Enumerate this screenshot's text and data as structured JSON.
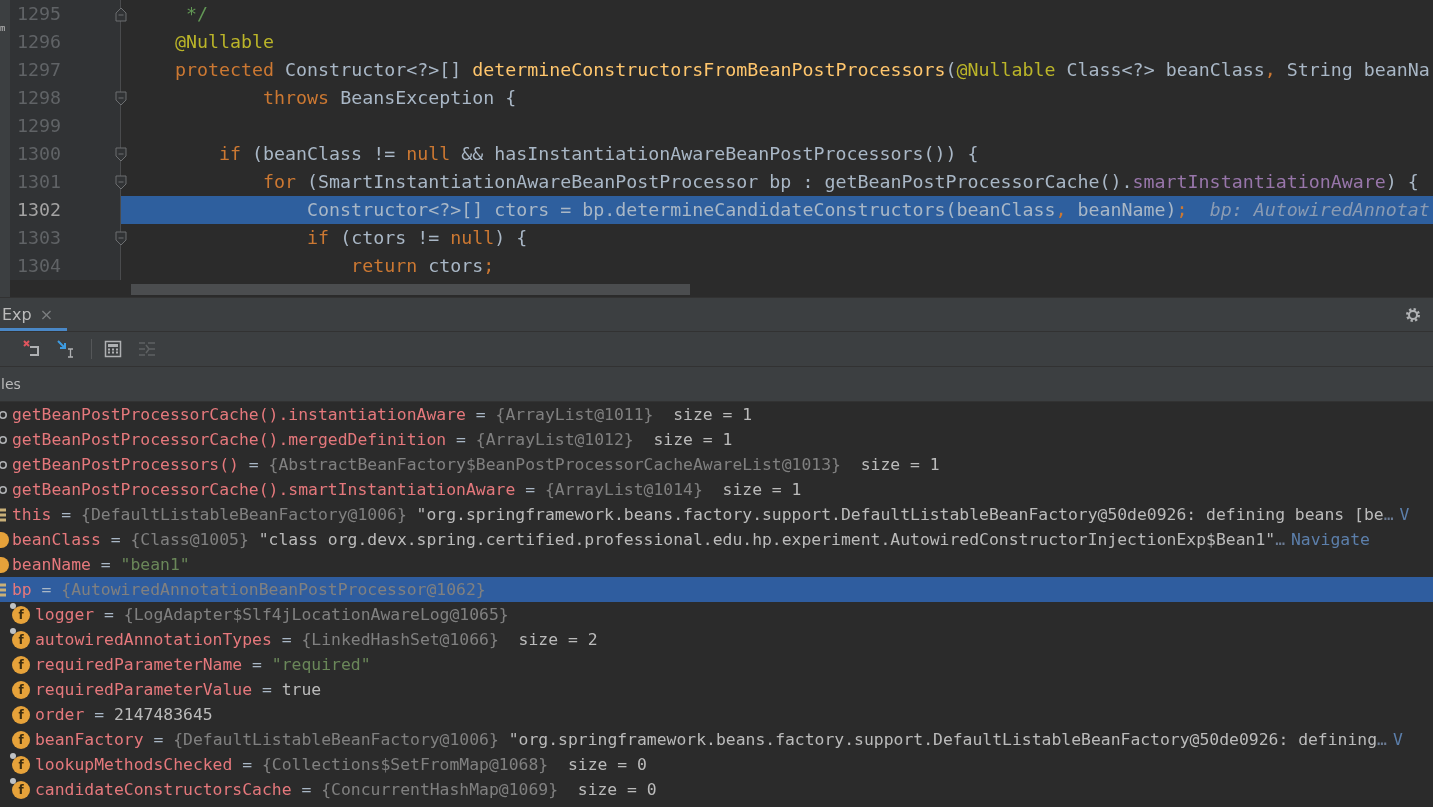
{
  "editor": {
    "edge_text": "m",
    "lines": [
      {
        "number": "1295",
        "current": false,
        "fold_start": false,
        "fold_end": true,
        "tokens": [
          {
            "text": "     */",
            "kind": "comment"
          }
        ]
      },
      {
        "number": "1296",
        "current": false,
        "fold_start": false,
        "fold_end": false,
        "tokens": [
          {
            "text": "    @Nullable",
            "kind": "annotation"
          }
        ]
      },
      {
        "number": "1297",
        "current": false,
        "fold_start": false,
        "fold_end": false,
        "tokens": [
          {
            "text": "    protected",
            "kind": "keyword"
          },
          {
            "text": " Constructor<?>[] ",
            "kind": "plain"
          },
          {
            "text": "determineConstructorsFromBeanPostProcessors",
            "kind": "method"
          },
          {
            "text": "(",
            "kind": "plain"
          },
          {
            "text": "@Nullable",
            "kind": "annotation"
          },
          {
            "text": " Class<?> beanClass",
            "kind": "plain"
          },
          {
            "text": ",",
            "kind": "keyword"
          },
          {
            "text": " String beanNa",
            "kind": "plain"
          }
        ]
      },
      {
        "number": "1298",
        "current": false,
        "fold_start": true,
        "fold_end": false,
        "tokens": [
          {
            "text": "            throws",
            "kind": "keyword"
          },
          {
            "text": " BeansException {",
            "kind": "plain"
          }
        ]
      },
      {
        "number": "1299",
        "current": false,
        "fold_start": false,
        "fold_end": false
      },
      {
        "number": "1300",
        "current": false,
        "fold_start": true,
        "fold_end": false,
        "tokens": [
          {
            "text": "        if",
            "kind": "keyword"
          },
          {
            "text": " (beanClass != ",
            "kind": "plain"
          },
          {
            "text": "null",
            "kind": "keyword"
          },
          {
            "text": " && hasInstantiationAwareBeanPostProcessors()) {",
            "kind": "plain"
          }
        ]
      },
      {
        "number": "1301",
        "current": false,
        "fold_start": true,
        "fold_end": false,
        "tokens": [
          {
            "text": "            for",
            "kind": "keyword"
          },
          {
            "text": " (SmartInstantiationAwareBeanPostProcessor bp : getBeanPostProcessorCache().",
            "kind": "plain"
          },
          {
            "text": "smartInstantiationAware",
            "kind": "field"
          },
          {
            "text": ") {",
            "kind": "plain"
          }
        ]
      },
      {
        "number": "1302",
        "current": true,
        "fold_start": false,
        "fold_end": false,
        "tokens": [
          {
            "text": "                Constructor<?>[] ctors = bp.determineCandidateConstructors(beanClass",
            "kind": "plain"
          },
          {
            "text": ",",
            "kind": "keyword"
          },
          {
            "text": " beanName)",
            "kind": "plain"
          },
          {
            "text": ";",
            "kind": "keyword"
          }
        ],
        "hint": "bp: AutowiredAnnotat"
      },
      {
        "number": "1303",
        "current": false,
        "fold_start": true,
        "fold_end": false,
        "tokens": [
          {
            "text": "                if",
            "kind": "keyword"
          },
          {
            "text": " (ctors != ",
            "kind": "plain"
          },
          {
            "text": "null",
            "kind": "keyword"
          },
          {
            "text": ") {",
            "kind": "plain"
          }
        ]
      },
      {
        "number": "1304",
        "current": false,
        "fold_start": false,
        "fold_end": false,
        "tokens": [
          {
            "text": "                    return",
            "kind": "keyword"
          },
          {
            "text": " ctors",
            "kind": "plain"
          },
          {
            "text": ";",
            "kind": "keyword"
          }
        ]
      }
    ]
  },
  "debugger": {
    "tab": {
      "label": "Exp",
      "close": "×",
      "selected": true
    },
    "header": "les",
    "variables": [
      {
        "kind": "watch",
        "selected": false,
        "name": "getBeanPostProcessorCache().instantiationAware",
        "parts": [
          {
            "text": "=",
            "kind": "op"
          },
          {
            "text": "{ArrayList@1011}",
            "kind": "ref"
          },
          {
            "text": "size = 1",
            "kind": "size"
          }
        ]
      },
      {
        "kind": "watch",
        "selected": false,
        "name": "getBeanPostProcessorCache().mergedDefinition",
        "parts": [
          {
            "text": "=",
            "kind": "op"
          },
          {
            "text": "{ArrayList@1012}",
            "kind": "ref"
          },
          {
            "text": "size = 1",
            "kind": "size"
          }
        ]
      },
      {
        "kind": "watch",
        "selected": false,
        "name": "getBeanPostProcessors()",
        "parts": [
          {
            "text": "=",
            "kind": "op"
          },
          {
            "text": "{AbstractBeanFactory$BeanPostProcessorCacheAwareList@1013}",
            "kind": "ref"
          },
          {
            "text": "size = 1",
            "kind": "size"
          }
        ]
      },
      {
        "kind": "watch",
        "selected": false,
        "name": "getBeanPostProcessorCache().smartInstantiationAware",
        "parts": [
          {
            "text": "=",
            "kind": "op"
          },
          {
            "text": "{ArrayList@1014}",
            "kind": "ref"
          },
          {
            "text": "size = 1",
            "kind": "size"
          }
        ]
      },
      {
        "kind": "object",
        "selected": false,
        "name": "this",
        "parts": [
          {
            "text": "=",
            "kind": "op"
          },
          {
            "text": "{DefaultListableBeanFactory@1006}",
            "kind": "ref"
          },
          {
            "text": "\"org.springframework.beans.factory.support.DefaultListableBeanFactory@50de0926: defining beans [be",
            "kind": "text"
          },
          {
            "text": "…",
            "kind": "ellipsis"
          },
          {
            "text": "V",
            "kind": "link"
          }
        ]
      },
      {
        "kind": "param",
        "selected": false,
        "name": "beanClass",
        "parts": [
          {
            "text": "=",
            "kind": "op"
          },
          {
            "text": "{Class@1005}",
            "kind": "ref"
          },
          {
            "text": "\"class org.devx.spring.certified.professional.edu.hp.experiment.AutowiredConstructorInjectionExp$Bean1\"",
            "kind": "text"
          },
          {
            "text": "…",
            "kind": "ellipsis"
          },
          {
            "text": "Navigate",
            "kind": "link"
          }
        ]
      },
      {
        "kind": "param",
        "selected": false,
        "name": "beanName",
        "parts": [
          {
            "text": "=",
            "kind": "op"
          },
          {
            "text": "\"bean1\"",
            "kind": "literal"
          }
        ]
      },
      {
        "kind": "object",
        "selected": true,
        "name": "bp",
        "parts": [
          {
            "text": "=",
            "kind": "op"
          },
          {
            "text": "{AutowiredAnnotationBeanPostProcessor@1062}",
            "kind": "ref"
          }
        ],
        "children": [
          {
            "kind": "field",
            "badge": "f",
            "final": true,
            "selected": false,
            "name": "logger",
            "parts": [
              {
                "text": "=",
                "kind": "op"
              },
              {
                "text": "{LogAdapter$Slf4jLocationAwareLog@1065}",
                "kind": "ref"
              }
            ]
          },
          {
            "kind": "field",
            "badge": "f",
            "final": true,
            "selected": false,
            "name": "autowiredAnnotationTypes",
            "parts": [
              {
                "text": "=",
                "kind": "op"
              },
              {
                "text": "{LinkedHashSet@1066}",
                "kind": "ref"
              },
              {
                "text": "size = 2",
                "kind": "size"
              }
            ]
          },
          {
            "kind": "field",
            "badge": "f",
            "final": false,
            "selected": false,
            "name": "requiredParameterName",
            "parts": [
              {
                "text": "=",
                "kind": "op"
              },
              {
                "text": "\"required\"",
                "kind": "literal"
              }
            ]
          },
          {
            "kind": "field",
            "badge": "f",
            "final": false,
            "selected": false,
            "name": "requiredParameterValue",
            "parts": [
              {
                "text": "=",
                "kind": "op"
              },
              {
                "text": "true",
                "kind": "text"
              }
            ]
          },
          {
            "kind": "field",
            "badge": "f",
            "final": false,
            "selected": false,
            "name": "order",
            "parts": [
              {
                "text": "=",
                "kind": "op"
              },
              {
                "text": "2147483645",
                "kind": "text"
              }
            ]
          },
          {
            "kind": "field",
            "badge": "f",
            "final": false,
            "selected": false,
            "name": "beanFactory",
            "parts": [
              {
                "text": "=",
                "kind": "op"
              },
              {
                "text": "{DefaultListableBeanFactory@1006}",
                "kind": "ref"
              },
              {
                "text": "\"org.springframework.beans.factory.support.DefaultListableBeanFactory@50de0926: defining",
                "kind": "text"
              },
              {
                "text": "…",
                "kind": "ellipsis"
              },
              {
                "text": "V",
                "kind": "link"
              }
            ]
          },
          {
            "kind": "field",
            "badge": "f",
            "final": true,
            "selected": false,
            "name": "lookupMethodsChecked",
            "parts": [
              {
                "text": "=",
                "kind": "op"
              },
              {
                "text": "{Collections$SetFromMap@1068}",
                "kind": "ref"
              },
              {
                "text": "size = 0",
                "kind": "size"
              }
            ]
          },
          {
            "kind": "field",
            "badge": "f",
            "final": true,
            "selected": false,
            "name": "candidateConstructorsCache",
            "parts": [
              {
                "text": "=",
                "kind": "op"
              },
              {
                "text": "{ConcurrentHashMap@1069}",
                "kind": "ref"
              },
              {
                "text": "size = 0",
                "kind": "size"
              }
            ]
          }
        ]
      }
    ]
  }
}
